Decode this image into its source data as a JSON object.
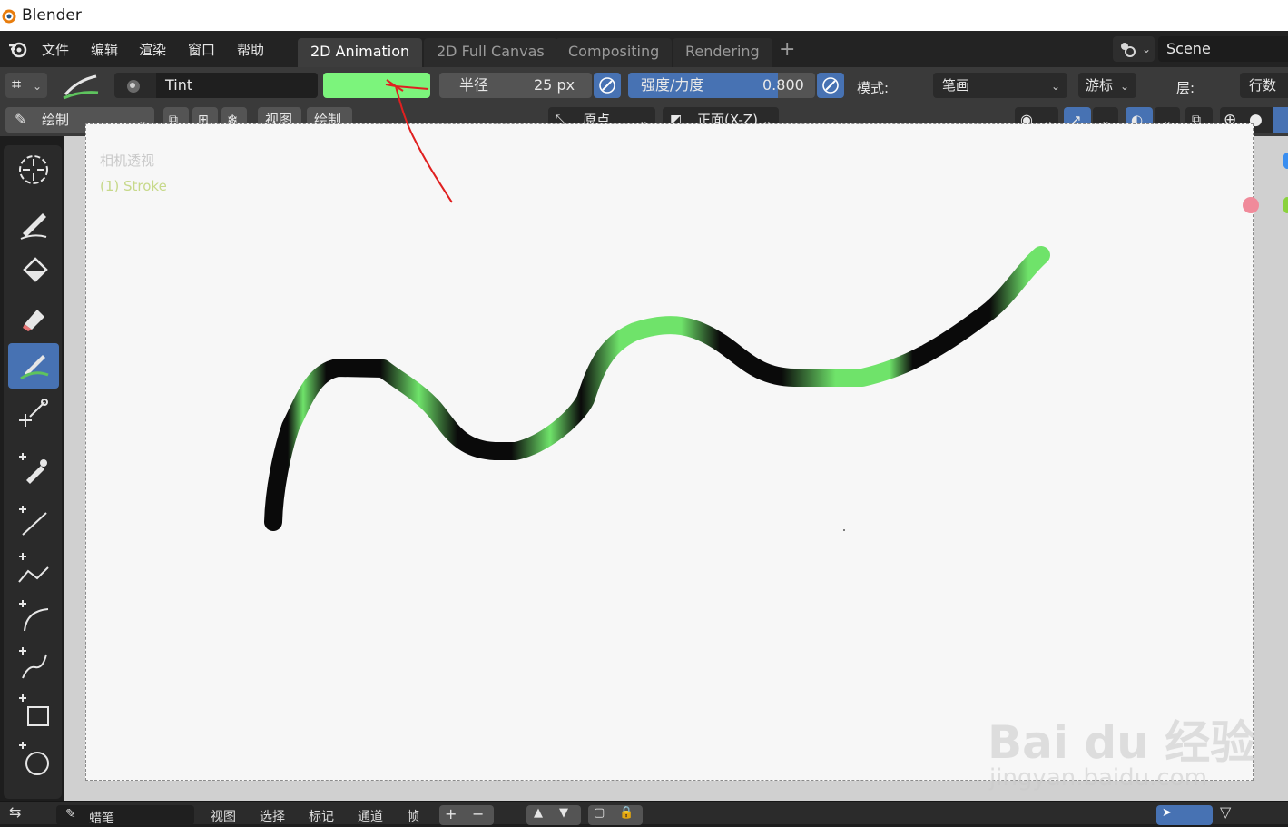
{
  "titlebar": {
    "title": "Blender"
  },
  "menu": {
    "items": [
      "文件",
      "编辑",
      "渲染",
      "窗口",
      "帮助"
    ]
  },
  "workspaces": {
    "tabs": [
      "2D Animation",
      "2D Full Canvas",
      "Compositing",
      "Rendering"
    ],
    "add": "+"
  },
  "scene": {
    "label": "Scene"
  },
  "brush": {
    "name": "Tint",
    "color": "#7cf47c",
    "radius_label": "半径",
    "radius_value": "25 px",
    "strength_label": "强度/力度",
    "strength_value": "0.800",
    "strength": 0.8,
    "mode_label": "模式:",
    "mode_value": "笔画",
    "cursor_label": "游标",
    "layer_label": "层:",
    "rows_label": "行数"
  },
  "header2": {
    "mode": "绘制",
    "view": "视图",
    "draw": "绘制",
    "origin": "原点",
    "orientation": "正面(X-Z)"
  },
  "viewport": {
    "camera_label": "相机透视",
    "object_label": "(1) Stroke"
  },
  "timeline": {
    "mode": "蜡笔",
    "items": [
      "视图",
      "选择",
      "标记",
      "通道",
      "帧"
    ]
  },
  "watermark": {
    "line1": "Bai du 经验",
    "line2": "jingyan.baidu.com"
  },
  "colors": {
    "accent": "#4772b3",
    "stroke_dark": "#0a0a0a",
    "stroke_green": "#6fe36a"
  }
}
